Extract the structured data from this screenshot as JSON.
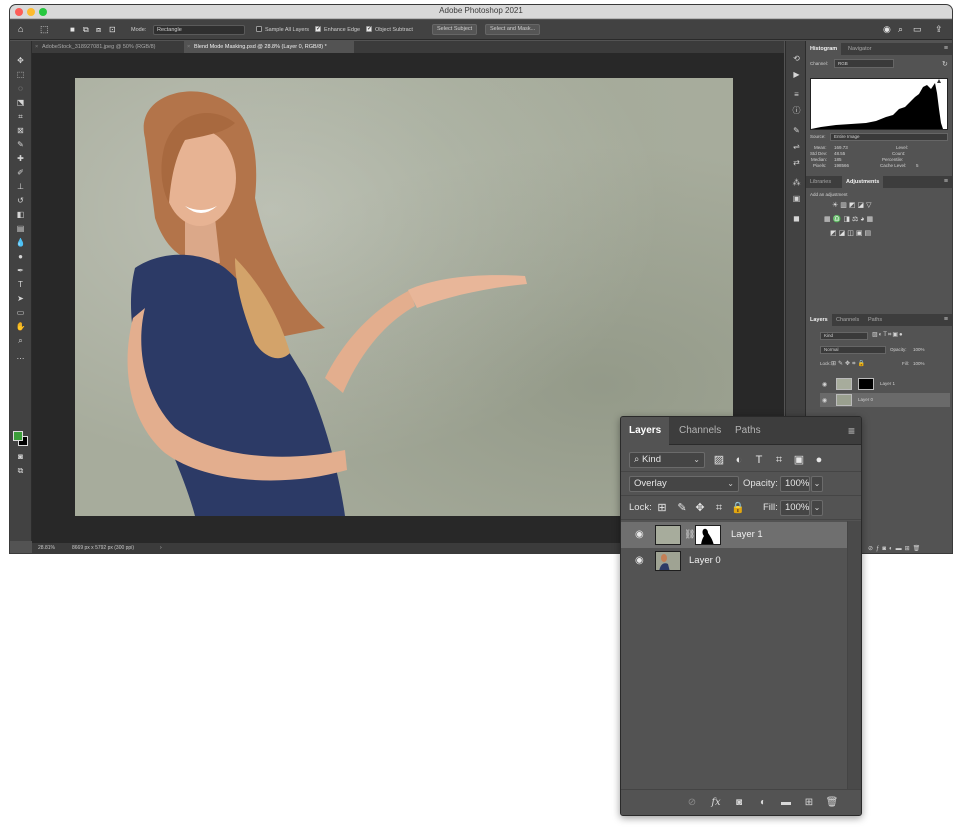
{
  "app": {
    "title": "Adobe Photoshop 2021"
  },
  "options_bar": {
    "mode_label": "Mode:",
    "mode_value": "Rectangle",
    "sample_all_layers": "Sample All Layers",
    "enhance_edge": "Enhance Edge",
    "object_subtract": "Object Subtract",
    "select_subject": "Select Subject",
    "select_and_mask": "Select and Mask..."
  },
  "doc_tabs": [
    {
      "label": "AdobeStock_318927081.jpeg @ 50% (RGB/8)"
    },
    {
      "label": "Blend Mode Masking.psd @ 28.8% (Layer 0, RGB/8) *"
    }
  ],
  "status": {
    "zoom": "28.81%",
    "dims": "8669 px x 5792 px (300 ppi)"
  },
  "histogram_panel": {
    "tabs": [
      "Histogram",
      "Navigator"
    ],
    "channel_label": "Channel:",
    "channel_value": "RGB",
    "source_label": "Source:",
    "source_value": "Entire Image",
    "stats": {
      "mean_label": "Mean:",
      "mean": "169.73",
      "std_label": "Std Dev:",
      "std": "48.55",
      "median_label": "Median:",
      "median": "185",
      "pixels_label": "Pixels:",
      "pixels": "198566",
      "level_label": "Level:",
      "count_label": "Count:",
      "percentile_label": "Percentile:",
      "cache_label": "Cache Level:",
      "cache": "5"
    }
  },
  "adjust_panel": {
    "tabs": [
      "Libraries",
      "Adjustments"
    ],
    "hint": "Add an adjustment"
  },
  "small_layers": {
    "tabs": [
      "Layers",
      "Channels",
      "Paths"
    ],
    "kind": "Kind",
    "blend": "Normal",
    "opacity_label": "Opacity:",
    "opacity": "100%",
    "lock_label": "Lock:",
    "fill_label": "Fill:",
    "fill": "100%",
    "layers": [
      {
        "name": "Layer 1"
      },
      {
        "name": "Layer 0"
      }
    ]
  },
  "float_layers": {
    "tabs": [
      "Layers",
      "Channels",
      "Paths"
    ],
    "kind": "Kind",
    "blend": "Overlay",
    "opacity_label": "Opacity:",
    "opacity": "100%",
    "lock_label": "Lock:",
    "fill_label": "Fill:",
    "fill": "100%",
    "layers": [
      {
        "name": "Layer 1",
        "selected": true
      },
      {
        "name": "Layer 0",
        "selected": false
      }
    ],
    "footer_fx": "fx"
  },
  "colors": {
    "foreground": "#3c9e3a",
    "background": "#000000",
    "panel": "#535353",
    "dark": "#282828"
  }
}
